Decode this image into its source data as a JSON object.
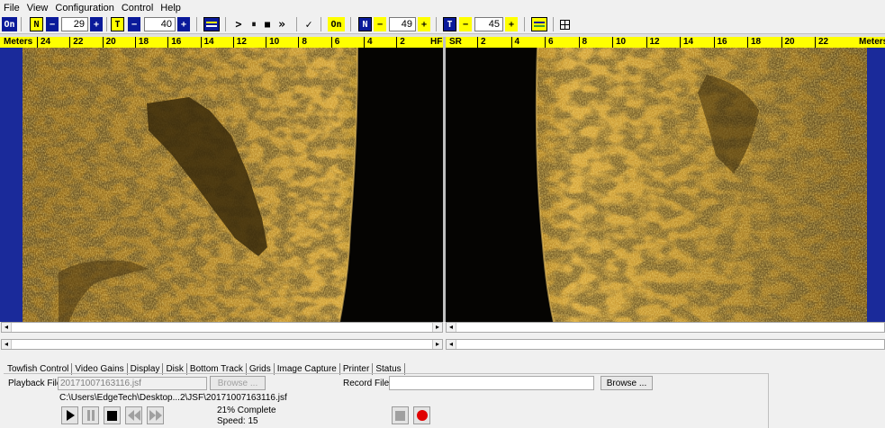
{
  "menu": [
    "File",
    "View",
    "Configuration",
    "Control",
    "Help"
  ],
  "toolbar": {
    "port_on": "On",
    "port_n_letter": "N",
    "minus": "−",
    "plus": "+",
    "port_n_value": "29",
    "port_t_letter": "T",
    "port_t_value": "40",
    "play": ">",
    "pause": "⏸",
    "stop": "■",
    "fast_forward": "»",
    "check": "✓",
    "stbd_on": "On",
    "stbd_n_value": "49",
    "stbd_t_value": "45"
  },
  "scale_left": {
    "title": "Meters",
    "ticks": [
      "24",
      "22",
      "20",
      "18",
      "16",
      "14",
      "12",
      "10",
      "8",
      "6",
      "4",
      "2"
    ],
    "end_label": "HF"
  },
  "scale_right": {
    "start_label": "SR",
    "ticks": [
      "2",
      "4",
      "6",
      "8",
      "10",
      "12",
      "14",
      "16",
      "18",
      "20",
      "22"
    ],
    "title": "Meters"
  },
  "colors": {
    "sonar_bright": "#e8b43a",
    "sonar_mid": "#a87818",
    "sonar_dark": "#3a2a08",
    "water_column": "#050402",
    "scale_yellow": "#ffff00",
    "toolbar_blue": "#0a1a9a"
  },
  "tabs": [
    "Towfish Control",
    "Video Gains",
    "Display",
    "Disk",
    "Bottom Track",
    "Grids",
    "Image Capture",
    "Printer",
    "Status"
  ],
  "active_tab": "Disk",
  "disk": {
    "playback_label": "Playback File:",
    "playback_value": "20171007163116.jsf",
    "browse_label": "Browse ...",
    "playback_path": "C:\\Users\\EdgeTech\\Desktop...2\\JSF\\20171007163116.jsf",
    "progress_text": "21% Complete",
    "progress": 0.21,
    "speed_text": "Speed: 15",
    "record_label": "Record File:",
    "record_value": "",
    "record_browse_label": "Browse ..."
  }
}
